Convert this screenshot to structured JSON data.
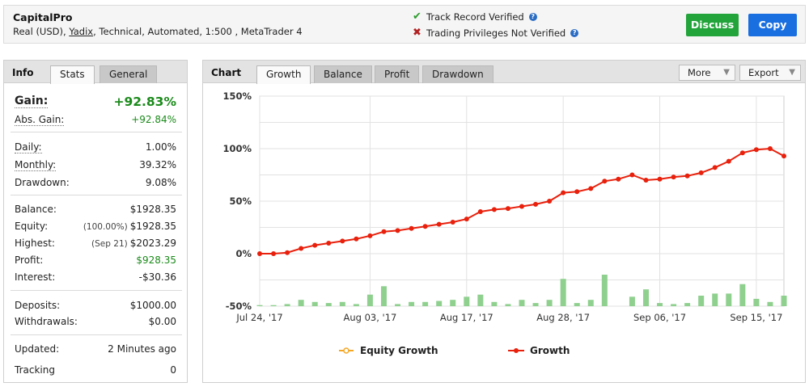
{
  "header": {
    "account_name": "CapitalPro",
    "desc_prefix": "Real (USD), ",
    "broker": "Yadix",
    "desc_suffix": ", Technical, Automated, 1:500 , MetaTrader 4",
    "track_record": "Track Record Verified",
    "trading_privileges": "Trading Privileges Not Verified",
    "discuss_label": "Discuss",
    "copy_label": "Copy",
    "help_icon": "?"
  },
  "info": {
    "title": "Info",
    "tabs": [
      "Stats",
      "General"
    ],
    "gain_label": "Gain:",
    "gain_value": "+92.83%",
    "abs_gain_label": "Abs. Gain:",
    "abs_gain_value": "+92.84%",
    "daily_label": "Daily:",
    "daily_value": "1.00%",
    "monthly_label": "Monthly:",
    "monthly_value": "39.32%",
    "drawdown_label": "Drawdown:",
    "drawdown_value": "9.08%",
    "balance_label": "Balance:",
    "balance_value": "$1928.35",
    "equity_label": "Equity:",
    "equity_sub": "(100.00%)",
    "equity_value": "$1928.35",
    "highest_label": "Highest:",
    "highest_sub": "(Sep 21)",
    "highest_value": "$2023.29",
    "profit_label": "Profit:",
    "profit_value": "$928.35",
    "interest_label": "Interest:",
    "interest_value": "-$30.36",
    "deposits_label": "Deposits:",
    "deposits_value": "$1000.00",
    "withdrawals_label": "Withdrawals:",
    "withdrawals_value": "$0.00",
    "updated_label": "Updated:",
    "updated_value": "2 Minutes ago",
    "tracking_label": "Tracking",
    "tracking_value": "0"
  },
  "chart_panel": {
    "title": "Chart",
    "tabs": [
      "Growth",
      "Balance",
      "Profit",
      "Drawdown"
    ],
    "active_tab": "Growth",
    "more_label": "More",
    "export_label": "Export"
  },
  "colors": {
    "growth_line": "#e8200c",
    "equity_line": "#f5a623",
    "bars": "#8fd08f",
    "discuss": "#22a43a",
    "copy": "#1a6fe0"
  },
  "chart_data": {
    "type": "line",
    "ylim": [
      -50,
      150
    ],
    "yticks": [
      -50,
      0,
      50,
      100,
      150
    ],
    "ytick_labels": [
      "-50%",
      "0%",
      "50%",
      "100%",
      "150%"
    ],
    "xtick_labels": [
      "Jul 24, '17",
      "Aug 03, '17",
      "Aug 17, '17",
      "Aug 28, '17",
      "Sep 06, '17",
      "Sep 15, '17"
    ],
    "xtick_index": [
      0,
      8,
      15,
      22,
      29,
      36
    ],
    "grid": true,
    "legend_position": "bottom",
    "series": [
      {
        "name": "Equity Growth",
        "values": []
      },
      {
        "name": "Growth",
        "values": [
          0,
          0,
          1,
          5,
          8,
          10,
          12,
          14,
          17,
          21,
          22,
          24,
          26,
          28,
          30,
          33,
          40,
          42,
          43,
          45,
          47,
          50,
          58,
          59,
          62,
          69,
          71,
          75,
          70,
          71,
          73,
          74,
          77,
          82,
          88,
          96,
          99,
          100,
          93
        ]
      }
    ],
    "bar_series": {
      "values": [
        -49,
        -49,
        -48,
        -44,
        -46,
        -47,
        -46,
        -48,
        -39,
        -31,
        -48,
        -46,
        -46,
        -45,
        -44,
        -41,
        -39,
        -46,
        -48,
        -44,
        -47,
        -44,
        -24,
        -47,
        -44,
        -20,
        -50,
        -41,
        -34,
        -47,
        -48,
        -47,
        -40,
        -38,
        -38,
        -29,
        -43,
        -46,
        -40
      ]
    }
  }
}
